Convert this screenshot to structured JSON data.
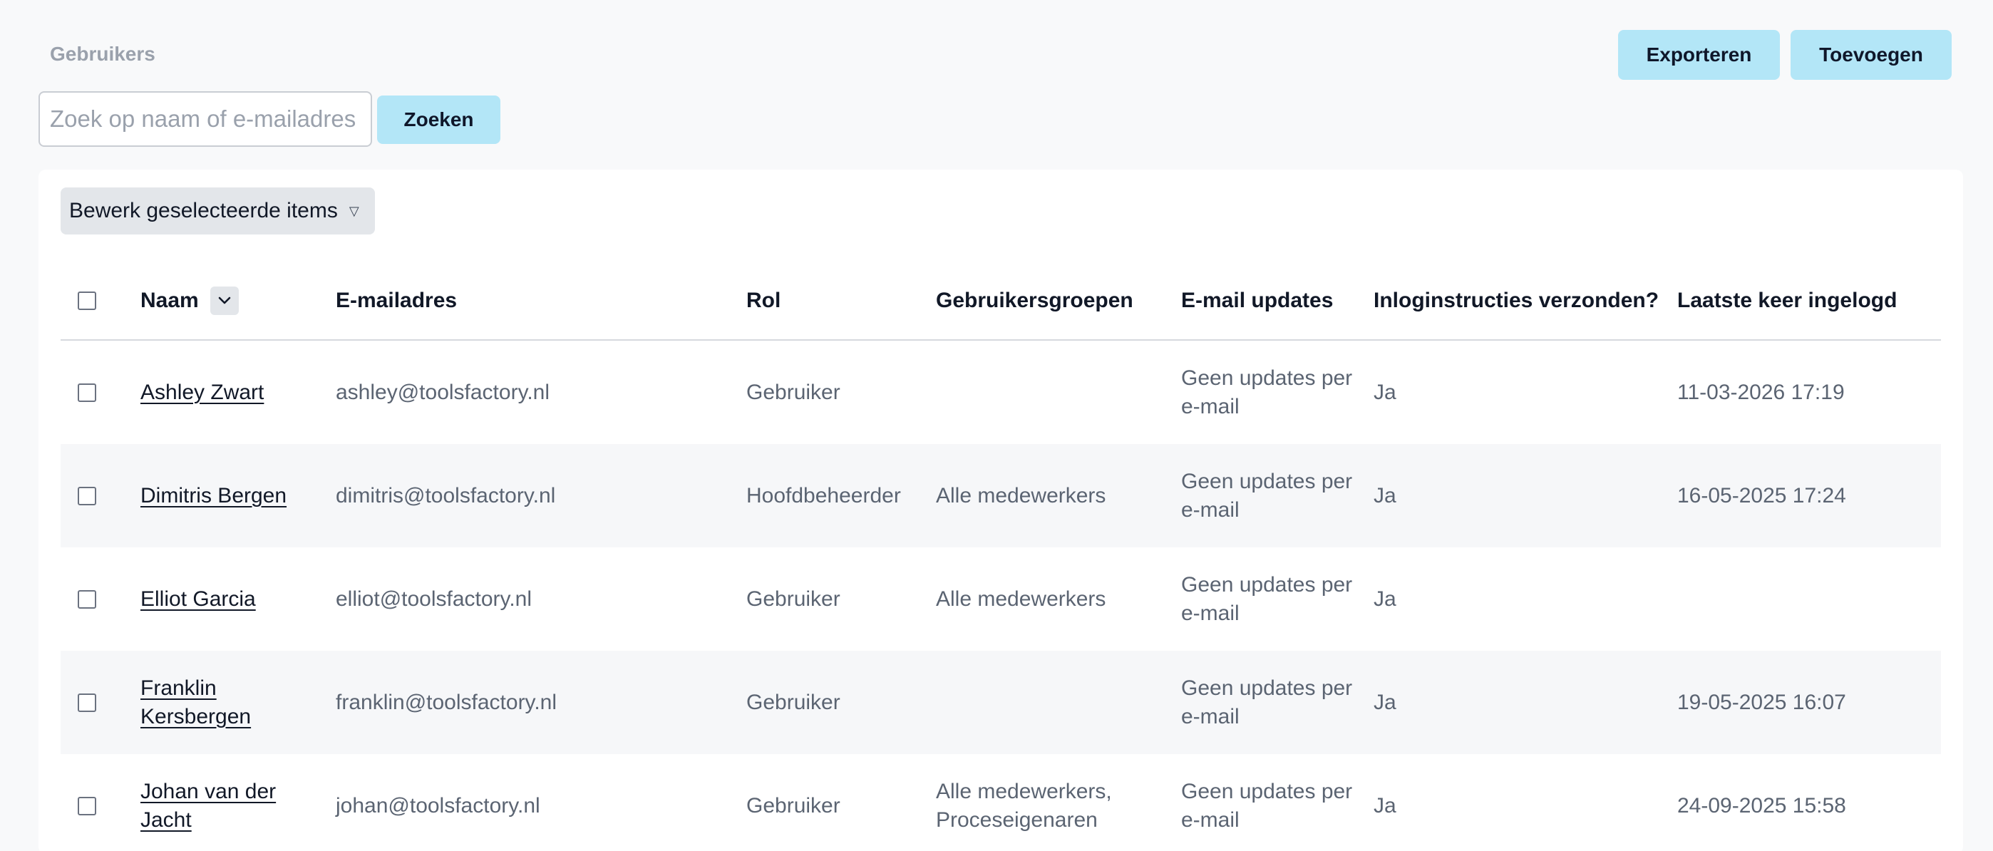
{
  "header": {
    "title": "Gebruikers",
    "export_label": "Exporteren",
    "add_label": "Toevoegen"
  },
  "search": {
    "placeholder": "Zoek op naam of e-mailadres",
    "button_label": "Zoeken"
  },
  "bulk": {
    "label": "Bewerk geselecteerde items",
    "caret": "▽"
  },
  "table": {
    "columns": {
      "name": "Naam",
      "email": "E-mailadres",
      "role": "Rol",
      "groups": "Gebruikersgroepen",
      "updates": "E-mail updates",
      "instructions": "Inloginstructies verzonden?",
      "last_login": "Laatste keer ingelogd"
    },
    "rows": [
      {
        "name": "Ashley Zwart",
        "email": "ashley@toolsfactory.nl",
        "role": "Gebruiker",
        "groups": "",
        "updates": "Geen updates per e-mail",
        "instructions": "Ja",
        "last_login": "11-03-2026 17:19"
      },
      {
        "name": "Dimitris Bergen",
        "email": "dimitris@toolsfactory.nl",
        "role": "Hoofdbeheerder",
        "groups": "Alle medewerkers",
        "updates": "Geen updates per e-mail",
        "instructions": "Ja",
        "last_login": "16-05-2025 17:24"
      },
      {
        "name": "Elliot Garcia",
        "email": "elliot@toolsfactory.nl",
        "role": "Gebruiker",
        "groups": "Alle medewerkers",
        "updates": "Geen updates per e-mail",
        "instructions": "Ja",
        "last_login": ""
      },
      {
        "name": "Franklin Kersbergen",
        "email": "franklin@toolsfactory.nl",
        "role": "Gebruiker",
        "groups": "",
        "updates": "Geen updates per e-mail",
        "instructions": "Ja",
        "last_login": "19-05-2025 16:07"
      },
      {
        "name": "Johan van der Jacht",
        "email": "johan@toolsfactory.nl",
        "role": "Gebruiker",
        "groups": "Alle medewerkers, Proceseigenaren",
        "updates": "Geen updates per e-mail",
        "instructions": "Ja",
        "last_login": "24-09-2025 15:58"
      }
    ]
  },
  "icons": {
    "sort": "chevron-down-icon",
    "dropdown": "caret-down-icon"
  },
  "colors": {
    "accent_button": "#b3e6f7",
    "row_alt": "#f6f7f9",
    "muted_text": "#5b6472"
  }
}
